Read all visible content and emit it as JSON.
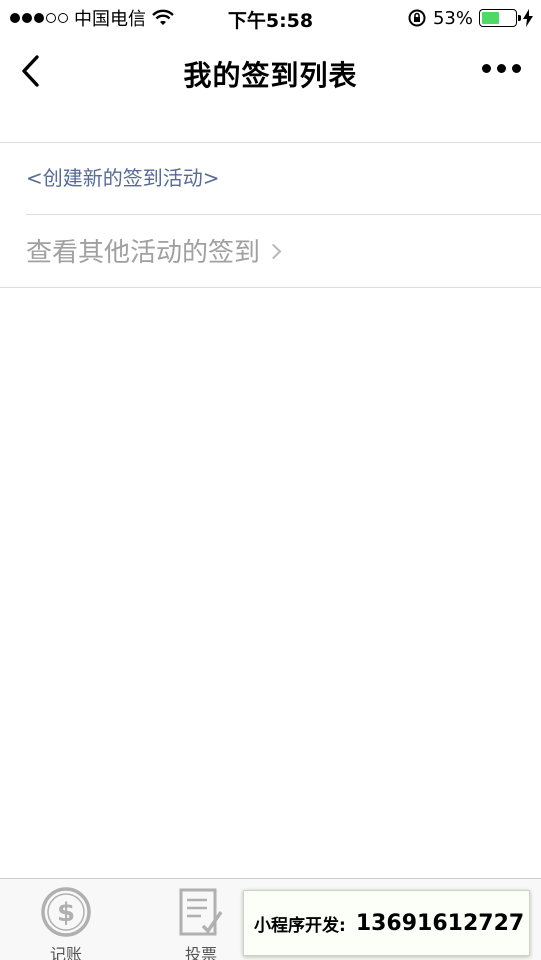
{
  "status_bar": {
    "carrier": "中国电信",
    "time": "下午5:58",
    "battery_percent": "53%",
    "battery_level": 0.53,
    "signal_bars_filled": 3,
    "signal_bars_total": 5
  },
  "nav": {
    "title": "我的签到列表"
  },
  "list": {
    "create_link": "<创建新的签到活动>",
    "view_other": "查看其他活动的签到"
  },
  "tabs": [
    {
      "label": "记账",
      "icon": "dollar-coin-icon"
    },
    {
      "label": "投票",
      "icon": "checklist-icon"
    }
  ],
  "promo": {
    "label": "小程序开发:",
    "number": "13691612727"
  },
  "colors": {
    "link": "#576b95",
    "muted": "#a0a0a0",
    "battery": "#4cd964"
  }
}
